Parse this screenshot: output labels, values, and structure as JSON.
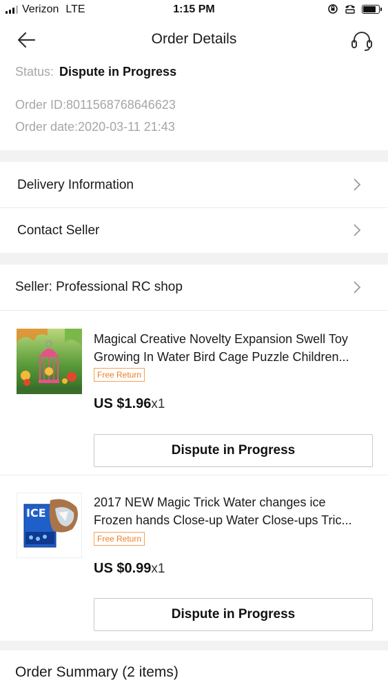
{
  "status_bar": {
    "carrier": "Verizon",
    "network": "LTE",
    "time": "1:15 PM",
    "battery_level": 0.75
  },
  "nav": {
    "title": "Order Details",
    "back_icon": "arrow-left-icon",
    "support_icon": "headset-icon"
  },
  "order": {
    "status_label": "Status:",
    "status_value": "Dispute in Progress",
    "order_id": "Order ID:8011568768646623",
    "order_date": "Order date:2020-03-11 21:43"
  },
  "rows": {
    "delivery": "Delivery Information",
    "contact": "Contact Seller",
    "seller": "Seller: Professional RC shop"
  },
  "products": [
    {
      "title_line1": "Magical Creative Novelty Expansion Swell Toy",
      "title_line2": "Growing In Water Bird Cage Puzzle Children...",
      "badge": "Free Return",
      "price": "US $1.96",
      "qty": "x1",
      "button": "Dispute in Progress"
    },
    {
      "title_line1": "2017 NEW Magic Trick Water changes ice",
      "title_line2": "Frozen hands Close-up Water Close-ups Tric...",
      "badge": "Free Return",
      "price": "US $0.99",
      "qty": "x1",
      "button": "Dispute in Progress",
      "thumb_text": "ICE"
    }
  ],
  "summary": {
    "title": "Order Summary (2 items)"
  },
  "colors": {
    "badge_orange": "#f07a22",
    "muted_gray": "#a6a6a6",
    "section_gap": "#f2f2f2"
  }
}
